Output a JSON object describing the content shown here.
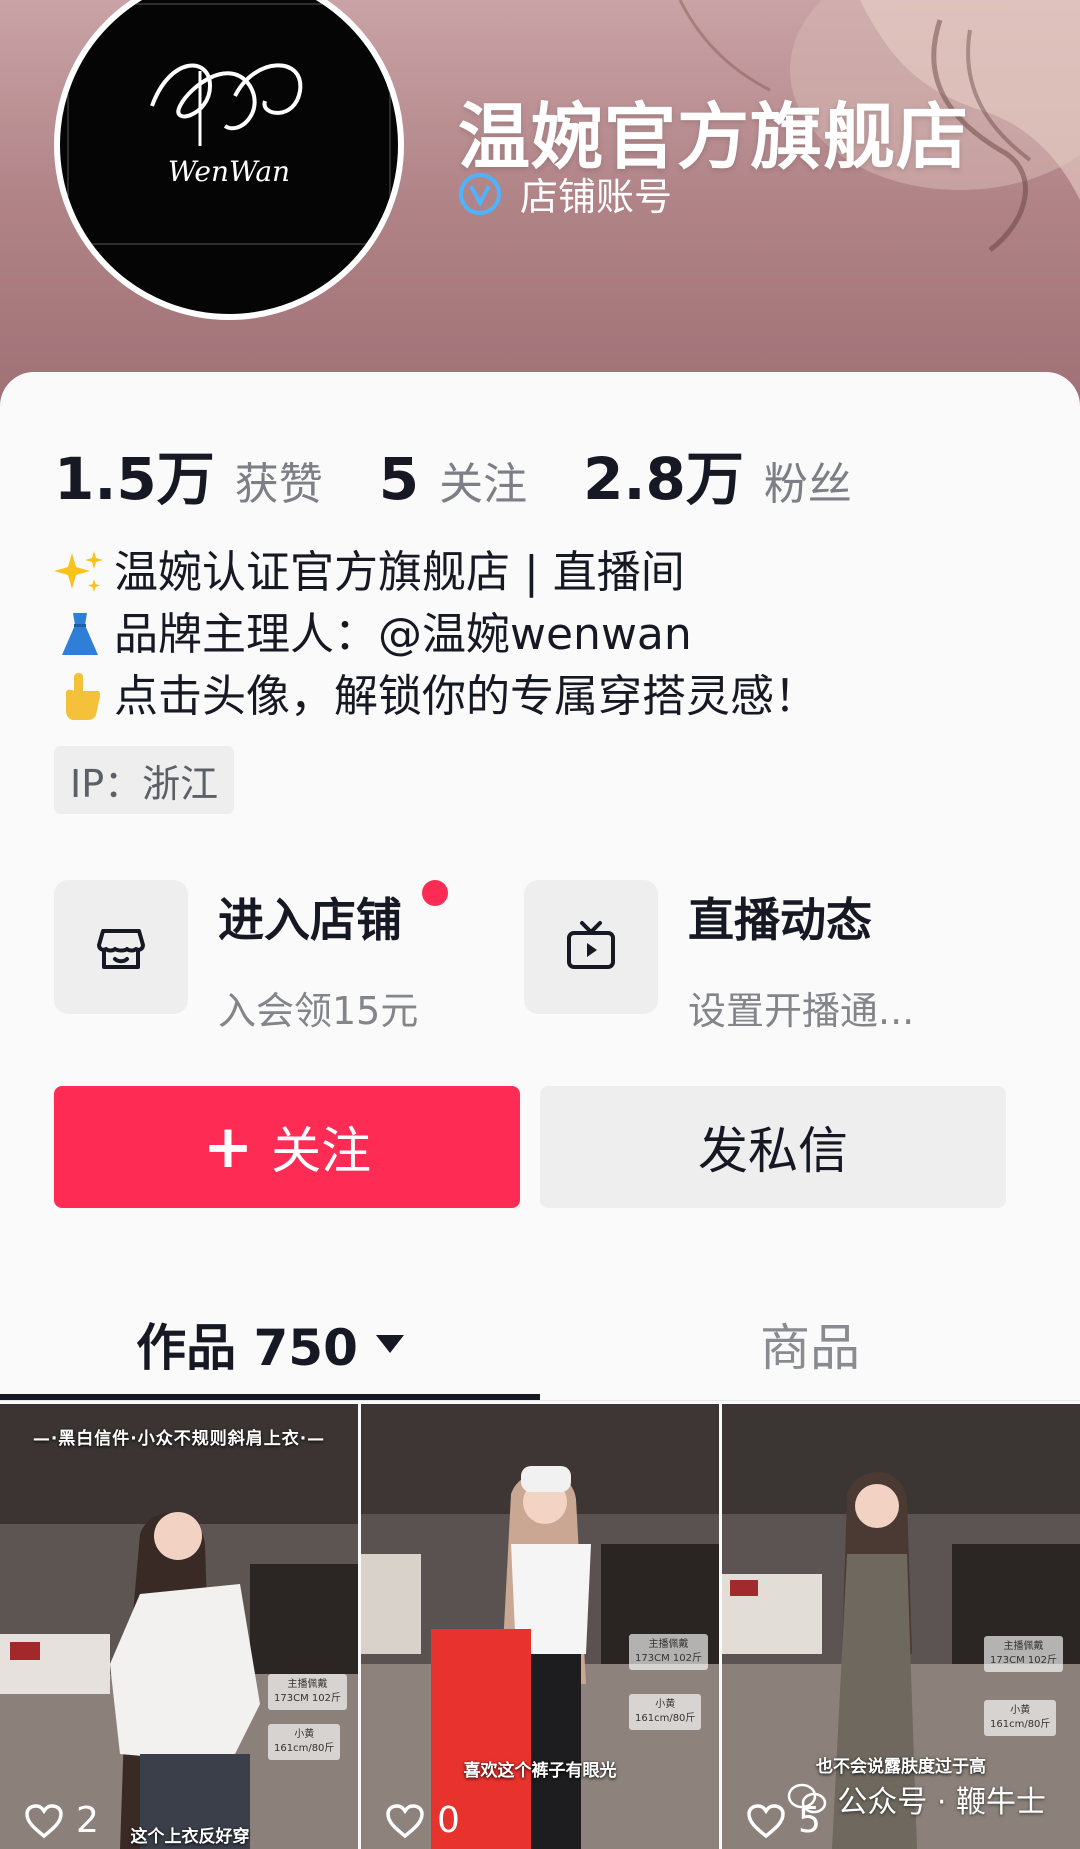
{
  "profile": {
    "shop_name": "温婉官方旗舰店",
    "verify_label": "店铺账号",
    "avatar_logo": "WenWan"
  },
  "stats": [
    {
      "value": "1.5万",
      "label": "获赞"
    },
    {
      "value": "5",
      "label": "关注"
    },
    {
      "value": "2.8万",
      "label": "粉丝"
    }
  ],
  "bio": {
    "line1": "温婉认证官方旗舰店 | 直播间",
    "line2": "品牌主理人：@温婉wenwan",
    "line3": "点击头像，解锁你的专属穿搭灵感！"
  },
  "ip": "IP：浙江",
  "quick_links": {
    "store": {
      "title": "进入店铺",
      "subtitle": "入会领15元",
      "icon": "store-icon"
    },
    "live": {
      "title": "直播动态",
      "subtitle": "设置开播通...",
      "icon": "tv-icon"
    }
  },
  "buttons": {
    "follow_plus": "+",
    "follow": "关注",
    "message": "发私信"
  },
  "tabs": {
    "works": "作品 750",
    "goods": "商品"
  },
  "videos": [
    {
      "top_caption": "—·黑白信件·小众不规则斜肩上衣·—",
      "bottom_caption": "这个上衣反好穿",
      "tag1": "主播佩戴",
      "tag2": "173CM 102斤",
      "tag3": "小黄",
      "tag4": "161cm/80斤",
      "likes": "2"
    },
    {
      "top_caption": "",
      "bottom_caption": "喜欢这个裤子有眼光",
      "tag1": "主播佩戴",
      "tag2": "173CM 102斤",
      "tag3": "小黄",
      "tag4": "161cm/80斤",
      "likes": "0"
    },
    {
      "top_caption": "",
      "bottom_caption": "也不会说露肤度过于高",
      "tag1": "主播佩戴",
      "tag2": "173CM 102斤",
      "tag3": "小黄",
      "tag4": "161cm/80斤",
      "likes": "5"
    }
  ],
  "watermark": "公众号 · 鞭牛士",
  "colors": {
    "accent": "#fe2c55",
    "banner": "#b18488",
    "verify_blue": "#4fb3ff"
  }
}
